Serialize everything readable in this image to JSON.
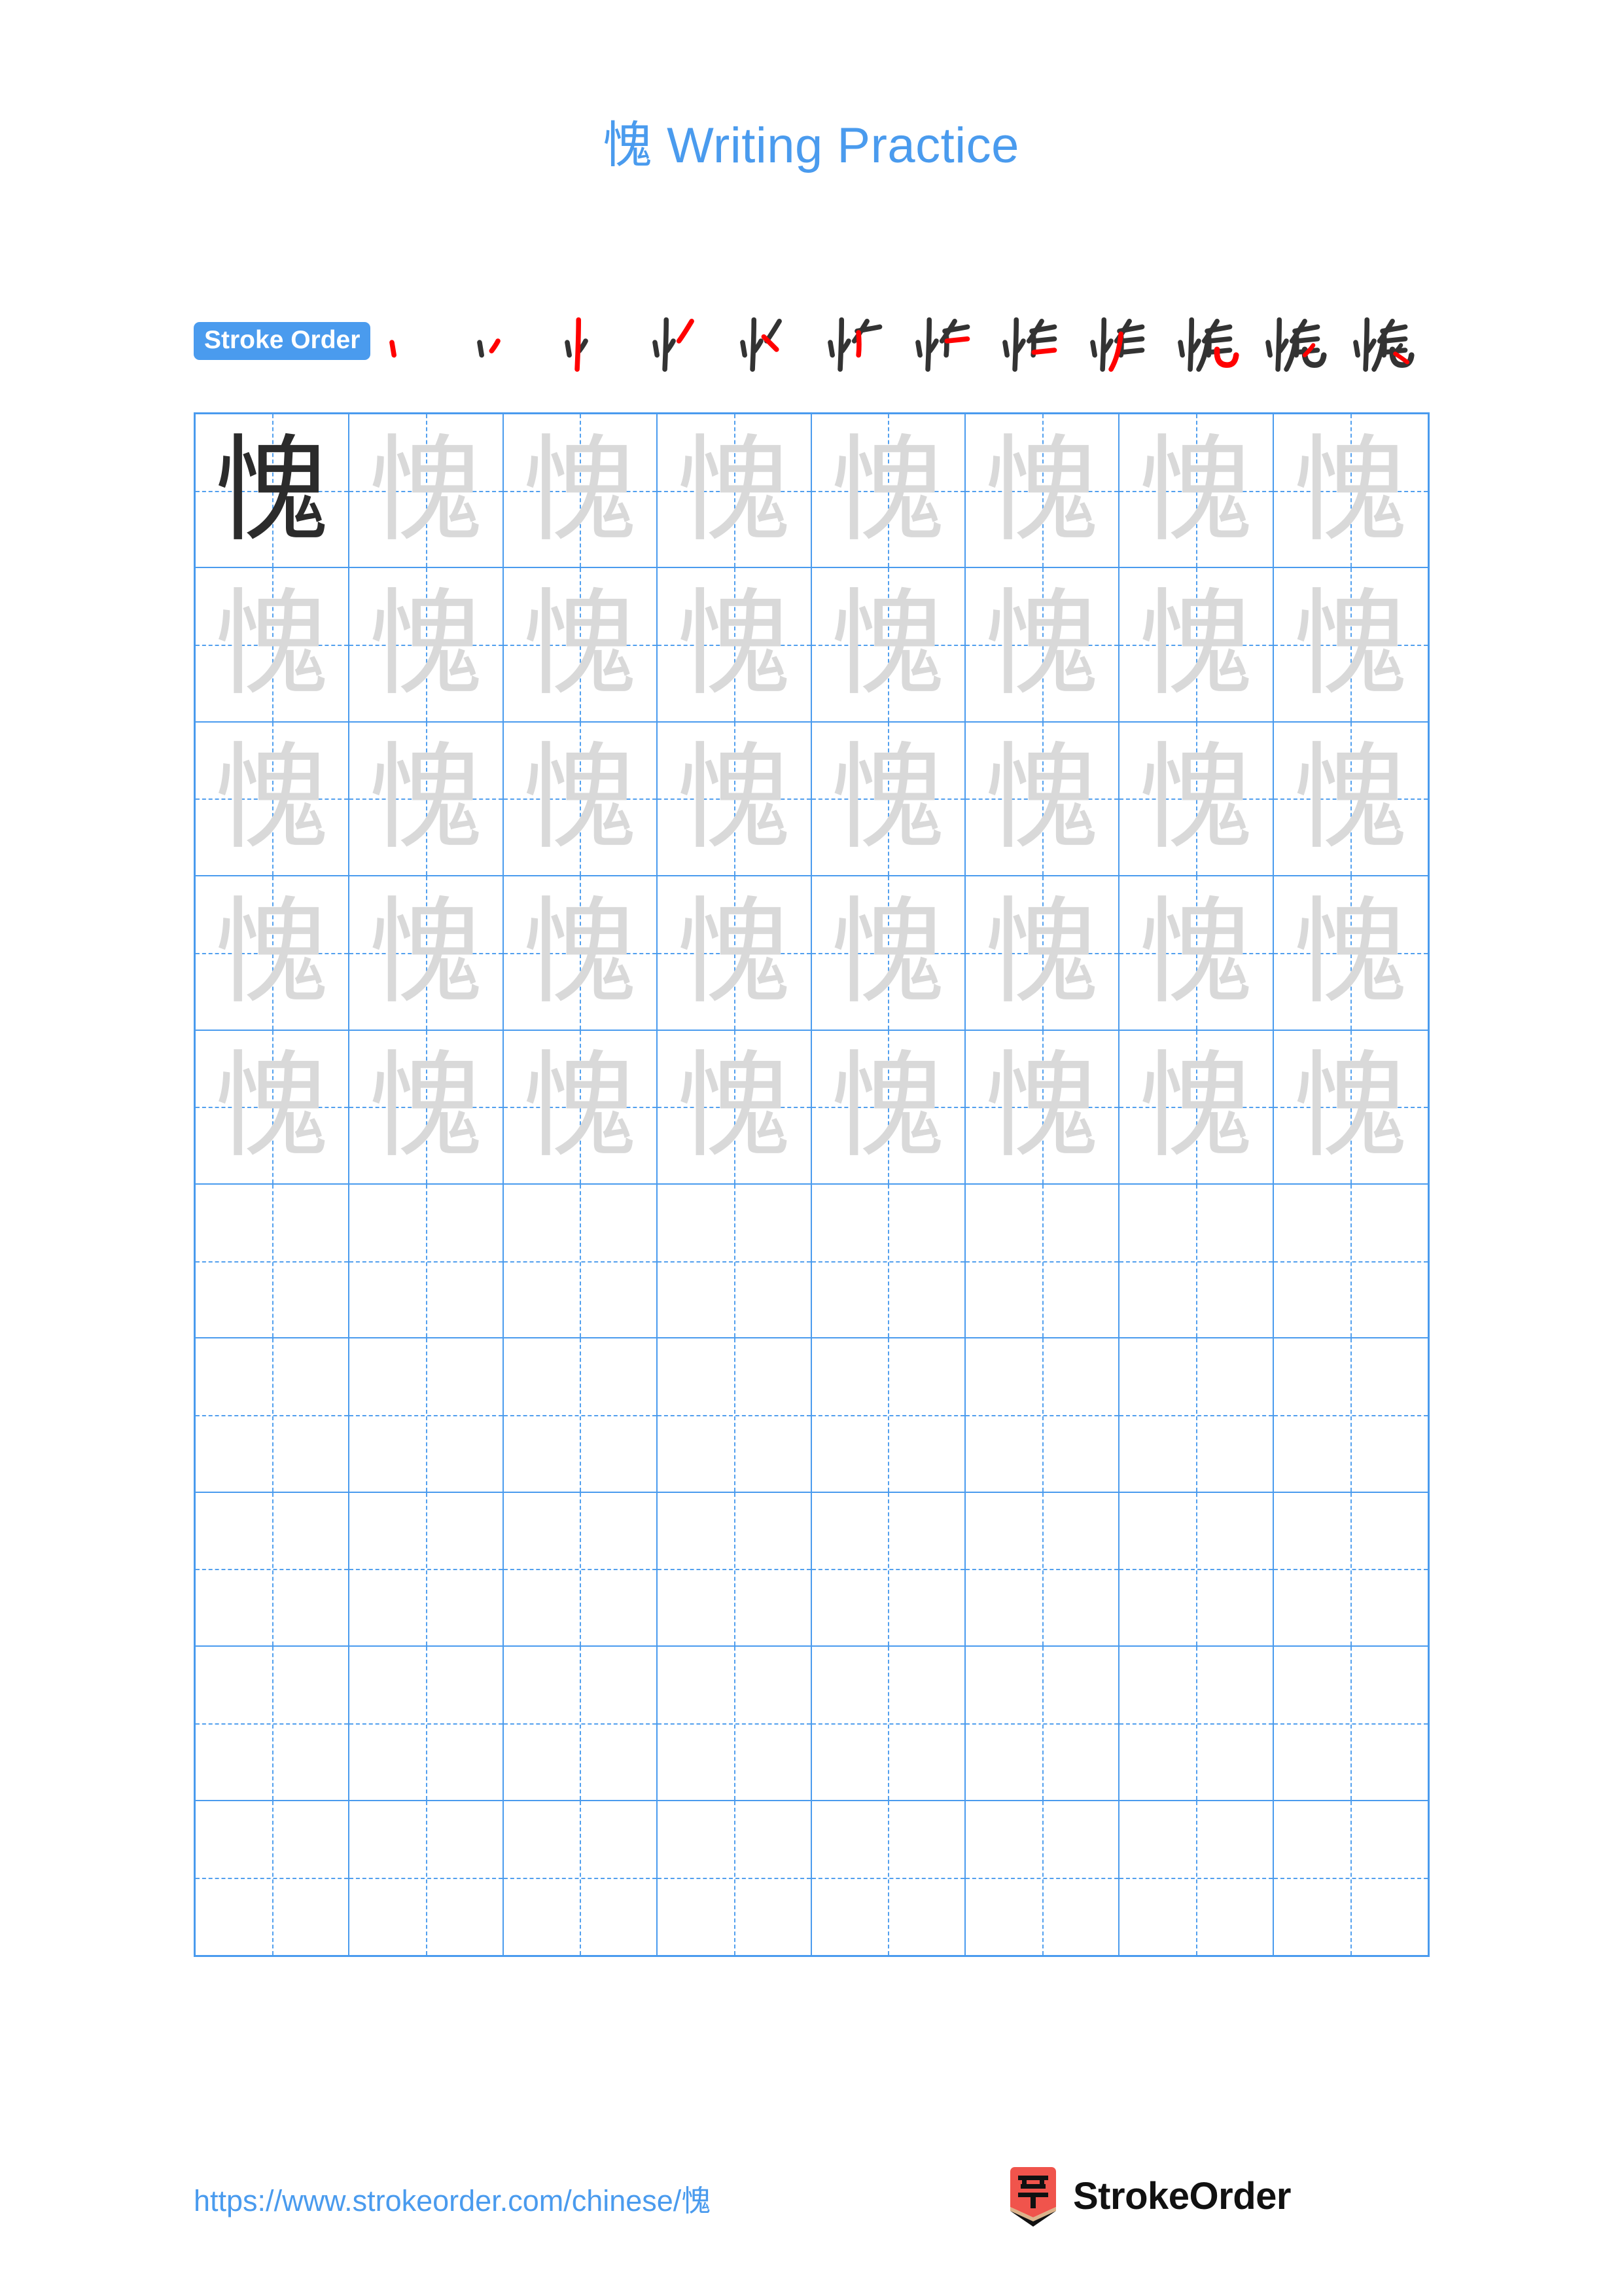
{
  "character": "愧",
  "header": {
    "title_char": "愧",
    "title_text": " Writing Practice",
    "title_color": "#4a9bee"
  },
  "stroke_order": {
    "badge_label": "Stroke Order",
    "badge_bg": "#4a9bee",
    "badge_text_color": "#ffffff",
    "new_stroke_color": "#ff0000",
    "existing_stroke_color": "#333333",
    "total_strokes": 12,
    "steps": [
      {
        "index": 1,
        "strokes_shown": 1
      },
      {
        "index": 2,
        "strokes_shown": 2
      },
      {
        "index": 3,
        "strokes_shown": 3
      },
      {
        "index": 4,
        "strokes_shown": 4
      },
      {
        "index": 5,
        "strokes_shown": 5
      },
      {
        "index": 6,
        "strokes_shown": 6
      },
      {
        "index": 7,
        "strokes_shown": 7
      },
      {
        "index": 8,
        "strokes_shown": 8
      },
      {
        "index": 9,
        "strokes_shown": 9
      },
      {
        "index": 10,
        "strokes_shown": 10
      },
      {
        "index": 11,
        "strokes_shown": 11
      },
      {
        "index": 12,
        "strokes_shown": 12
      }
    ]
  },
  "grid": {
    "columns": 8,
    "rows": 10,
    "line_color": "#4a9bee",
    "model_char_color": "#2b2b2b",
    "trace_char_color": "#d9d9d9",
    "cells": [
      [
        "model",
        "trace",
        "trace",
        "trace",
        "trace",
        "trace",
        "trace",
        "trace"
      ],
      [
        "trace",
        "trace",
        "trace",
        "trace",
        "trace",
        "trace",
        "trace",
        "trace"
      ],
      [
        "trace",
        "trace",
        "trace",
        "trace",
        "trace",
        "trace",
        "trace",
        "trace"
      ],
      [
        "trace",
        "trace",
        "trace",
        "trace",
        "trace",
        "trace",
        "trace",
        "trace"
      ],
      [
        "trace",
        "trace",
        "trace",
        "trace",
        "trace",
        "trace",
        "trace",
        "trace"
      ],
      [
        "blank",
        "blank",
        "blank",
        "blank",
        "blank",
        "blank",
        "blank",
        "blank"
      ],
      [
        "blank",
        "blank",
        "blank",
        "blank",
        "blank",
        "blank",
        "blank",
        "blank"
      ],
      [
        "blank",
        "blank",
        "blank",
        "blank",
        "blank",
        "blank",
        "blank",
        "blank"
      ],
      [
        "blank",
        "blank",
        "blank",
        "blank",
        "blank",
        "blank",
        "blank",
        "blank"
      ],
      [
        "blank",
        "blank",
        "blank",
        "blank",
        "blank",
        "blank",
        "blank",
        "blank"
      ]
    ]
  },
  "footer": {
    "url_text": "https://www.strokeorder.com/chinese/",
    "url_char": "愧",
    "url_color": "#4a9bee",
    "brand_name": "StrokeOrder",
    "logo_char": "字",
    "logo_bg": "#f0544c",
    "logo_tip": "#dcb38a"
  }
}
